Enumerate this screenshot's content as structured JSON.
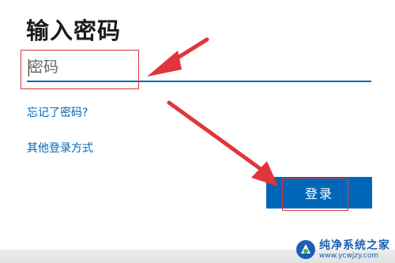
{
  "page": {
    "title": "输入密码"
  },
  "password_field": {
    "placeholder": "密码",
    "value": ""
  },
  "links": {
    "forgot": "忘记了密码?",
    "other_signin": "其他登录方式"
  },
  "signin_button": {
    "label": "登录"
  },
  "watermark": {
    "name": "纯净系统之家",
    "url": "www.ycwjzy.com"
  },
  "colors": {
    "accent": "#0067b8",
    "annotation_red": "#e0353a"
  },
  "icons": {
    "annotation_arrows": "red-arrow-icon",
    "watermark_logo": "logo-icon"
  }
}
